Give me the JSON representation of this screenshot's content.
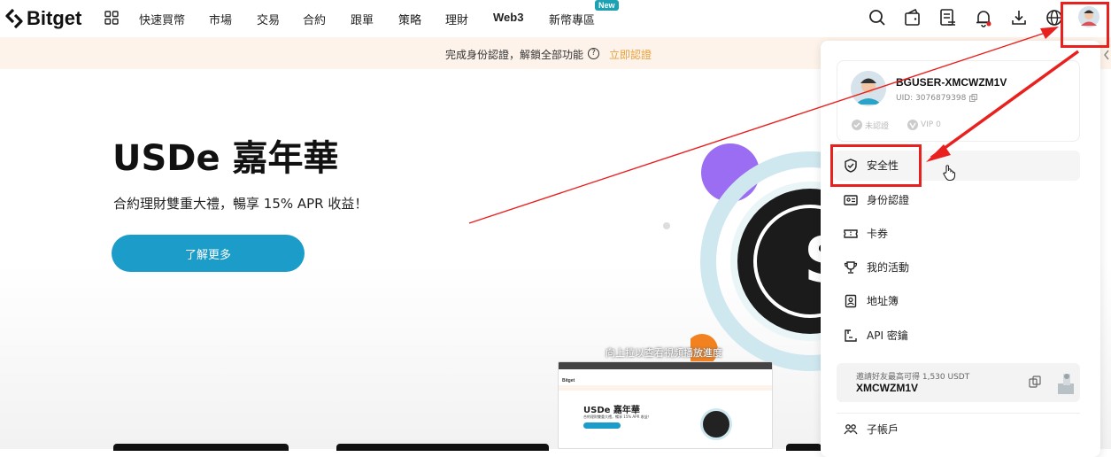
{
  "brand": {
    "name": "Bitget"
  },
  "nav": {
    "items": [
      "快速買幣",
      "市場",
      "交易",
      "合約",
      "跟單",
      "策略",
      "理財",
      "Web3",
      "新幣專區"
    ],
    "new_badge": "New"
  },
  "top_icons": [
    "search-icon",
    "wallet-icon",
    "orders-icon",
    "bell-icon",
    "download-icon",
    "globe-icon",
    "avatar"
  ],
  "banner": {
    "text": "完成身份認證，解鎖全部功能",
    "help": "?",
    "link": "立即認證"
  },
  "hero": {
    "title": "USDe 嘉年華",
    "subtitle": "合約理財雙重大禮，暢享 15% APR 收益！",
    "button": "了解更多"
  },
  "video": {
    "caption": "向上拉以查看視頻播放進度",
    "thumb_brand": "Bitget",
    "thumb_title": "USDe 嘉年華",
    "thumb_subtitle": "合約理財雙重大禮，暢享 15% APR 收益！"
  },
  "profile": {
    "username": "BGUSER-XMCWZM1V",
    "uid": "UID: 3076879398",
    "badge_kyc": "未認證",
    "badge_vip": "VIP 0"
  },
  "menu": [
    {
      "label": "安全性",
      "icon": "shield-check-icon"
    },
    {
      "label": "身份認證",
      "icon": "id-card-icon"
    },
    {
      "label": "卡券",
      "icon": "ticket-icon"
    },
    {
      "label": "我的活動",
      "icon": "trophy-icon"
    },
    {
      "label": "地址簿",
      "icon": "address-book-icon"
    },
    {
      "label": "API 密鑰",
      "icon": "api-key-icon"
    },
    {
      "label": "子帳戶",
      "icon": "sub-account-icon"
    }
  ],
  "referral": {
    "text": "邀請好友最高可得 1,530 USDT",
    "code": "XMCWZM1V"
  },
  "colors": {
    "accent": "#1c9cc8",
    "banner_bg": "#fdf3ea",
    "banner_link": "#e8a13c",
    "annotation_red": "#e8211f",
    "new_badge": "#1da2b4"
  }
}
